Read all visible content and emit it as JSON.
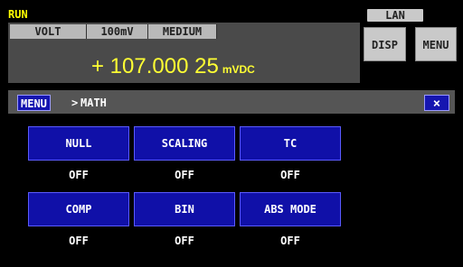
{
  "status": {
    "mode": "RUN",
    "interface": "LAN"
  },
  "measurement": {
    "function": "VOLT",
    "range": "100mV",
    "speed": "MEDIUM",
    "reading": "+ 107.000 25",
    "unit": "mVDC"
  },
  "side_buttons": {
    "disp": "DISP",
    "menu": "MENU"
  },
  "breadcrumb": {
    "root": "MENU",
    "separator": ">",
    "current": "MATH",
    "close": "×"
  },
  "functions": [
    {
      "label": "NULL",
      "state": "OFF"
    },
    {
      "label": "SCALING",
      "state": "OFF"
    },
    {
      "label": "TC",
      "state": "OFF"
    },
    {
      "label": "COMP",
      "state": "OFF"
    },
    {
      "label": "BIN",
      "state": "OFF"
    },
    {
      "label": "ABS MODE",
      "state": "OFF"
    }
  ],
  "colors": {
    "reading": "#ffff33",
    "button_blue": "#1010a8",
    "status_yellow": "#ffff00"
  }
}
